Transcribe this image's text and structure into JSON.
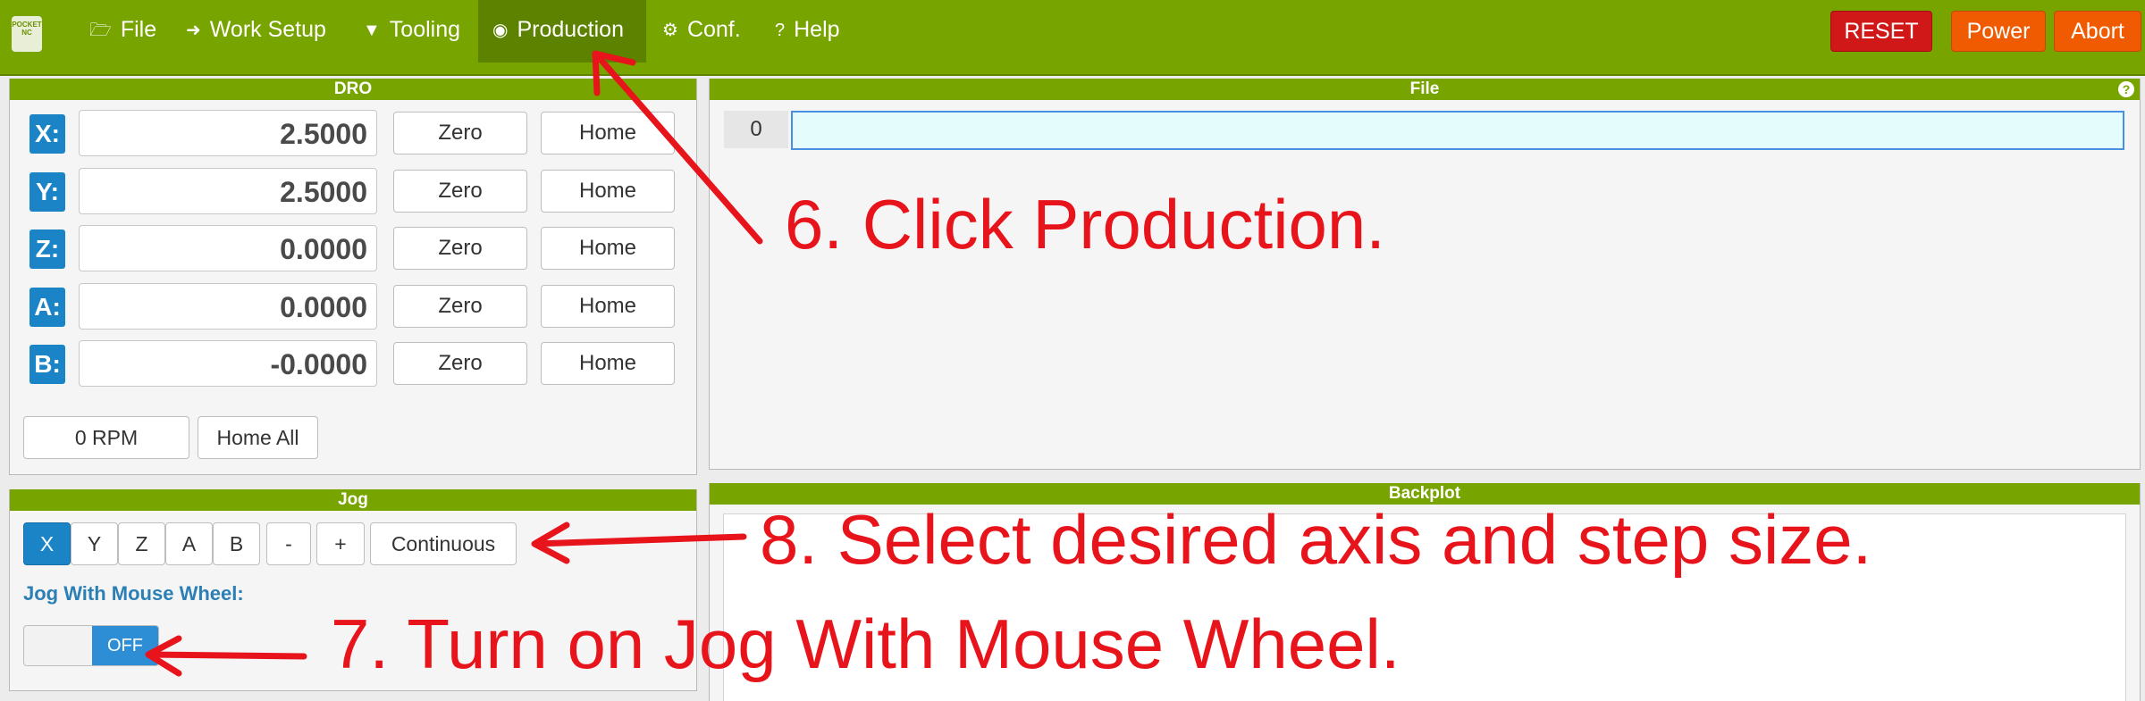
{
  "nav": {
    "logo_text": "POCKET NC",
    "items": [
      {
        "label": "File",
        "icon": "folder-open-icon",
        "glyph": "🗁"
      },
      {
        "label": "Work Setup",
        "icon": "sign-in-icon",
        "glyph": "➜"
      },
      {
        "label": "Tooling",
        "icon": "filter-icon",
        "glyph": "▼"
      },
      {
        "label": "Production",
        "icon": "play-circle-icon",
        "glyph": "◉"
      },
      {
        "label": "Conf.",
        "icon": "gears-icon",
        "glyph": "⚙"
      },
      {
        "label": "Help",
        "icon": "question-circle-icon",
        "glyph": "?"
      }
    ],
    "reset_label": "RESET",
    "power_label": "Power",
    "abort_label": "Abort"
  },
  "dro": {
    "title": "DRO",
    "axes": [
      {
        "label": "X:",
        "value": "2.5000"
      },
      {
        "label": "Y:",
        "value": "2.5000"
      },
      {
        "label": "Z:",
        "value": "0.0000"
      },
      {
        "label": "A:",
        "value": "0.0000"
      },
      {
        "label": "B:",
        "value": "-0.0000"
      }
    ],
    "zero_label": "Zero",
    "home_label": "Home",
    "rpm_value": "0 RPM",
    "home_all_label": "Home All"
  },
  "jog": {
    "title": "Jog",
    "axis_buttons": [
      "X",
      "Y",
      "Z",
      "A",
      "B"
    ],
    "selected_axis": "X",
    "minus_label": "-",
    "plus_label": "+",
    "step_label": "Continuous",
    "mouse_wheel_label": "Jog With Mouse Wheel:",
    "toggle_state": "OFF"
  },
  "file": {
    "title": "File",
    "help_glyph": "?",
    "line_number": "0",
    "line_text": ""
  },
  "backplot": {
    "title": "Backplot"
  },
  "annotations": {
    "step6": "6. Click Production.",
    "step8": "8. Select desired axis and step size.",
    "step7": "7. Turn on Jog With Mouse Wheel.",
    "color": "#e8141c"
  },
  "colors": {
    "brand_green": "#78a400",
    "accent_blue": "#1a84c6",
    "reset_red": "#d01818",
    "orange": "#f05a00"
  }
}
